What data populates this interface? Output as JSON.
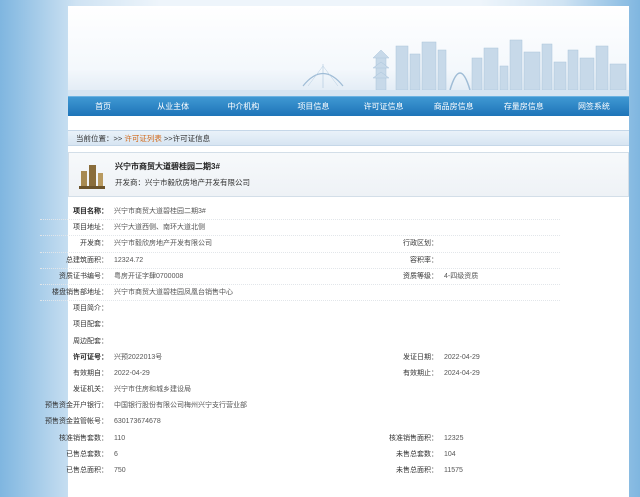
{
  "nav": [
    "首页",
    "从业主体",
    "中介机构",
    "项目信息",
    "许可证信息",
    "商品房信息",
    "存量房信息",
    "网签系统"
  ],
  "crumb": {
    "prefix": "当前位置：>> ",
    "link": "许可证列表",
    "suffix": " >>许可证信息"
  },
  "project": {
    "name": "兴宁市商贸大道碧桂园二期3#",
    "developer_label": "开发商：",
    "developer": "兴宁市毅欣房地产开发有限公司"
  },
  "rows": [
    {
      "l1": "项目名称：",
      "v1": "兴宁市商贸大道碧桂园二期3#",
      "l2": "",
      "v2": ""
    },
    {
      "l1": "项目地址：",
      "v1": "兴宁大道西侧、南环大道北侧",
      "l2": "",
      "v2": ""
    },
    {
      "l1": "开发商：",
      "v1": "兴宁市毅欣房地产开发有限公司",
      "l2": "行政区划：",
      "v2": ""
    },
    {
      "l1": "总建筑面积：",
      "v1": "12324.72",
      "l2": "容积率：",
      "v2": ""
    },
    {
      "l1": "资质证书编号：",
      "v1": "粤房开证字肆0700008",
      "l2": "资质等级：",
      "v2": "4-四级资质"
    },
    {
      "l1": "楼盘销售部地址：",
      "v1": "兴宁市商贸大道碧桂园凤凰台销售中心",
      "l2": "",
      "v2": ""
    },
    {
      "l1": "项目简介：",
      "v1": "",
      "l2": "",
      "v2": ""
    },
    {
      "l1": "项目配套：",
      "v1": "",
      "l2": "",
      "v2": ""
    },
    {
      "l1": "周边配套：",
      "v1": "",
      "l2": "",
      "v2": ""
    },
    {
      "l1": "许可证号：",
      "v1": "兴预2022013号",
      "l2": "发证日期：",
      "v2": "2022-04-29"
    },
    {
      "l1": "有效期自：",
      "v1": "2022-04-29",
      "l2": "有效期止：",
      "v2": "2024-04-29"
    },
    {
      "l1": "发证机关：",
      "v1": "兴宁市住房和城乡建设局",
      "l2": "",
      "v2": ""
    },
    {
      "l1": "预售资金开户银行：",
      "v1": "中国银行股份有限公司梅州兴宁支行营业部",
      "l2": "",
      "v2": ""
    },
    {
      "l1": "预售资金监管帐号：",
      "v1": "630173674678",
      "l2": "",
      "v2": ""
    },
    {
      "l1": "核准销售套数：",
      "v1": "110",
      "l2": "核准销售面积：",
      "v2": "12325"
    },
    {
      "l1": "已售总套数：",
      "v1": "6",
      "l2": "未售总套数：",
      "v2": "104"
    },
    {
      "l1": "已售总面积：",
      "v1": "750",
      "l2": "未售总面积：",
      "v2": "11575"
    }
  ]
}
